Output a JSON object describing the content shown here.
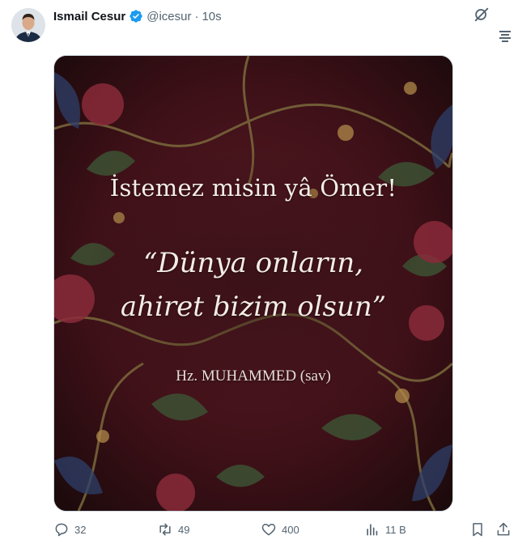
{
  "tweet": {
    "author_name": "Ismail Cesur",
    "handle": "@icesur",
    "separator": "·",
    "time": "10s",
    "verified_color": "#1d9bf0"
  },
  "image_text": {
    "line1": "İstemez misin yâ Ömer!",
    "line2": "“Dünya onların,",
    "line3": "ahiret bizim olsun”",
    "author": "Hz. MUHAMMED (sav)"
  },
  "actions": {
    "replies": "32",
    "reposts": "49",
    "likes": "400",
    "views": "11 B"
  },
  "icons": {
    "grok": "grok-icon",
    "more": "more-icon",
    "reply": "reply-icon",
    "repost": "repost-icon",
    "like": "heart-icon",
    "views": "views-icon",
    "bookmark": "bookmark-icon",
    "share": "share-icon"
  }
}
